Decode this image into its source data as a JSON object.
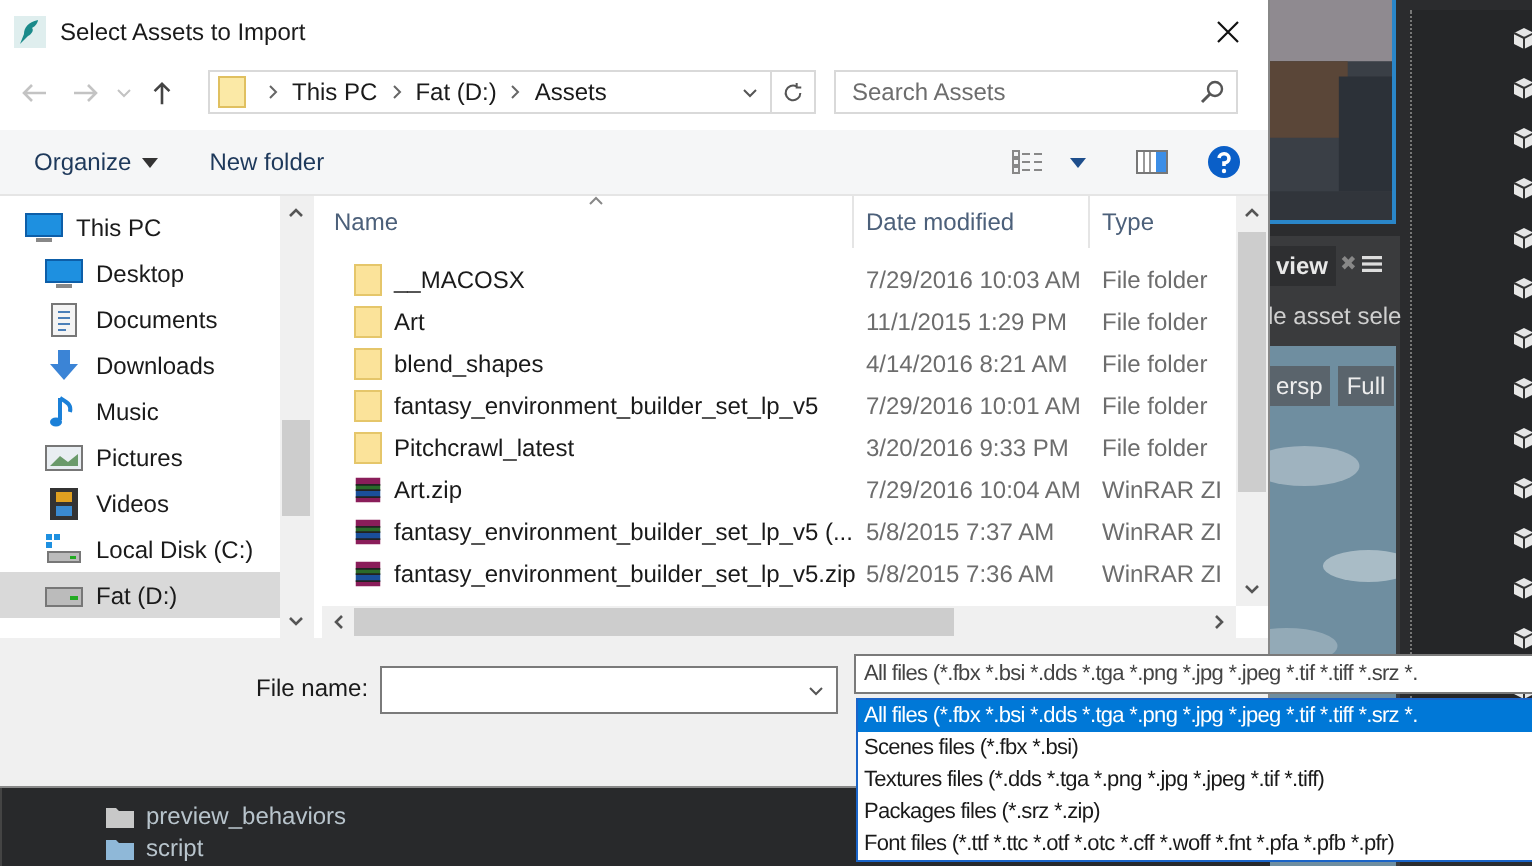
{
  "window": {
    "title": "Select Assets to Import"
  },
  "address": {
    "crumbs": [
      "This PC",
      "Fat (D:)",
      "Assets"
    ]
  },
  "search": {
    "placeholder": "Search Assets"
  },
  "toolbar": {
    "organize": "Organize",
    "new_folder": "New folder"
  },
  "nav": {
    "items": [
      {
        "label": "This PC",
        "kind": "pc",
        "selected": false
      },
      {
        "label": "Desktop",
        "kind": "desktop",
        "selected": false
      },
      {
        "label": "Documents",
        "kind": "documents",
        "selected": false
      },
      {
        "label": "Downloads",
        "kind": "downloads",
        "selected": false
      },
      {
        "label": "Music",
        "kind": "music",
        "selected": false
      },
      {
        "label": "Pictures",
        "kind": "pictures",
        "selected": false
      },
      {
        "label": "Videos",
        "kind": "videos",
        "selected": false
      },
      {
        "label": "Local Disk (C:)",
        "kind": "system-disk",
        "selected": false
      },
      {
        "label": "Fat (D:)",
        "kind": "disk",
        "selected": true
      }
    ]
  },
  "table": {
    "columns": [
      "Name",
      "Date modified",
      "Type"
    ],
    "rows": [
      {
        "name": "__MACOSX",
        "date": "7/29/2016 10:03 AM",
        "type": "File folder",
        "kind": "folder"
      },
      {
        "name": "Art",
        "date": "11/1/2015 1:29 PM",
        "type": "File folder",
        "kind": "folder"
      },
      {
        "name": "blend_shapes",
        "date": "4/14/2016 8:21 AM",
        "type": "File folder",
        "kind": "folder"
      },
      {
        "name": "fantasy_environment_builder_set_lp_v5",
        "date": "7/29/2016 10:01 AM",
        "type": "File folder",
        "kind": "folder"
      },
      {
        "name": "Pitchcrawl_latest",
        "date": "3/20/2016 9:33 PM",
        "type": "File folder",
        "kind": "folder"
      },
      {
        "name": "Art.zip",
        "date": "7/29/2016 10:04 AM",
        "type": "WinRAR ZI",
        "kind": "archive"
      },
      {
        "name": "fantasy_environment_builder_set_lp_v5 (...",
        "date": "5/8/2015 7:37 AM",
        "type": "WinRAR ZI",
        "kind": "archive"
      },
      {
        "name": "fantasy_environment_builder_set_lp_v5.zip",
        "date": "5/8/2015 7:36 AM",
        "type": "WinRAR ZI",
        "kind": "archive"
      }
    ]
  },
  "file_name": {
    "label": "File name:"
  },
  "filter": {
    "value": "All files (*.fbx *.bsi *.dds *.tga *.png *.jpg *.jpeg *.tif *.tiff *.srz *.",
    "options": [
      {
        "label": "All files (*.fbx *.bsi *.dds *.tga *.png *.jpg *.jpeg *.tif *.tiff *.srz *.",
        "selected": true
      },
      {
        "label": "Scenes files (*.fbx *.bsi)",
        "selected": false
      },
      {
        "label": "Textures files (*.dds *.tga *.png *.jpg *.jpeg *.tif *.tiff)",
        "selected": false
      },
      {
        "label": "Packages files (*.srz *.zip)",
        "selected": false
      },
      {
        "label": "Font files (*.ttf *.ttc *.otf *.otc *.cff *.woff *.fnt *.pfa *.pfb *.pfr)",
        "selected": false
      }
    ]
  },
  "background_app": {
    "tab_label": "view",
    "tab_close": "✖",
    "hint": "le asset sele",
    "buttons": [
      "ersp",
      "Full"
    ],
    "tree": [
      "preview_behaviors",
      "script"
    ]
  }
}
